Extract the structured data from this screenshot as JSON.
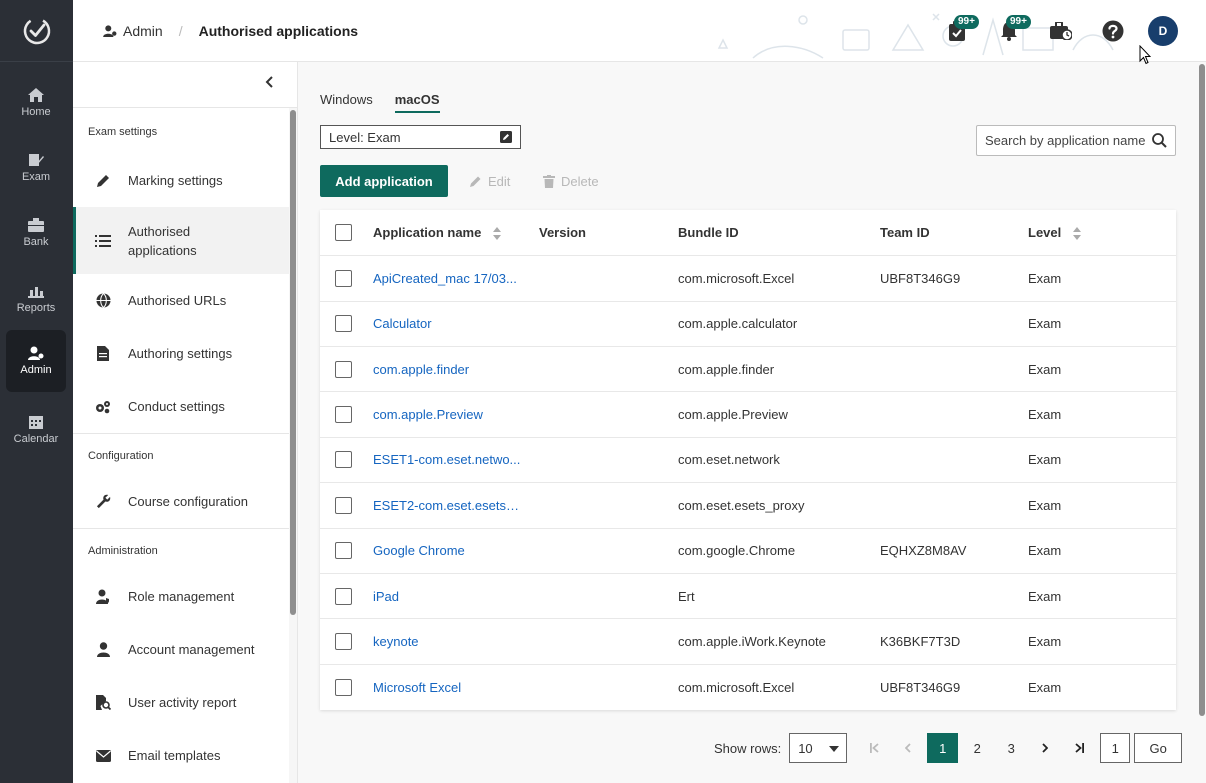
{
  "rail": {
    "items": [
      {
        "label": "Home",
        "icon": "home-icon"
      },
      {
        "label": "Exam",
        "icon": "exam-icon"
      },
      {
        "label": "Bank",
        "icon": "bank-icon"
      },
      {
        "label": "Reports",
        "icon": "reports-icon"
      },
      {
        "label": "Admin",
        "icon": "admin-icon",
        "active": true
      },
      {
        "label": "Calendar",
        "icon": "calendar-icon"
      }
    ]
  },
  "header": {
    "breadcrumb_root": "Admin",
    "breadcrumb_current": "Authorised applications",
    "task_badge": "99+",
    "notification_badge": "99+",
    "avatar_initial": "D"
  },
  "sidebar": {
    "sections": [
      {
        "title": "Exam settings",
        "items": [
          "Marking settings",
          "Authorised applications",
          "Authorised URLs",
          "Authoring settings",
          "Conduct settings"
        ]
      },
      {
        "title": "Configuration",
        "items": [
          "Course configuration"
        ]
      },
      {
        "title": "Administration",
        "items": [
          "Role management",
          "Account management",
          "User activity report",
          "Email templates"
        ]
      }
    ],
    "active_item": "Authorised applications"
  },
  "main": {
    "tabs": [
      {
        "label": "Windows"
      },
      {
        "label": "macOS",
        "active": true
      }
    ],
    "level_select": "Level: Exam",
    "search_placeholder": "Search by application name",
    "add_button": "Add application",
    "edit_button": "Edit",
    "delete_button": "Delete",
    "table": {
      "columns": [
        "Application name",
        "Version",
        "Bundle ID",
        "Team ID",
        "Level"
      ],
      "rows": [
        {
          "name": "ApiCreated_mac 17/03...",
          "version": "",
          "bundle": "com.microsoft.Excel",
          "team": "UBF8T346G9",
          "level": "Exam"
        },
        {
          "name": "Calculator",
          "version": "",
          "bundle": "com.apple.calculator",
          "team": "",
          "level": "Exam"
        },
        {
          "name": "com.apple.finder",
          "version": "",
          "bundle": "com.apple.finder",
          "team": "",
          "level": "Exam"
        },
        {
          "name": "com.apple.Preview",
          "version": "",
          "bundle": "com.apple.Preview",
          "team": "",
          "level": "Exam"
        },
        {
          "name": "ESET1-com.eset.netwo...",
          "version": "",
          "bundle": "com.eset.network",
          "team": "",
          "level": "Exam"
        },
        {
          "name": "ESET2-com.eset.esets_...",
          "version": "",
          "bundle": "com.eset.esets_proxy",
          "team": "",
          "level": "Exam"
        },
        {
          "name": "Google Chrome",
          "version": "",
          "bundle": "com.google.Chrome",
          "team": "EQHXZ8M8AV",
          "level": "Exam"
        },
        {
          "name": "iPad",
          "version": "",
          "bundle": "Ert",
          "team": "",
          "level": "Exam"
        },
        {
          "name": "keynote",
          "version": "",
          "bundle": "com.apple.iWork.Keynote",
          "team": "K36BKF7T3D",
          "level": "Exam"
        },
        {
          "name": "Microsoft Excel",
          "version": "",
          "bundle": "com.microsoft.Excel",
          "team": "UBF8T346G9",
          "level": "Exam"
        }
      ]
    },
    "pagination": {
      "show_rows_label": "Show rows:",
      "rows_per_page": "10",
      "pages": [
        "1",
        "2",
        "3"
      ],
      "current_page": "1",
      "goto_value": "1",
      "go_label": "Go"
    }
  },
  "colors": {
    "accent": "#0e6a5e",
    "rail_bg": "#2b2f36",
    "link": "#1565c0"
  }
}
